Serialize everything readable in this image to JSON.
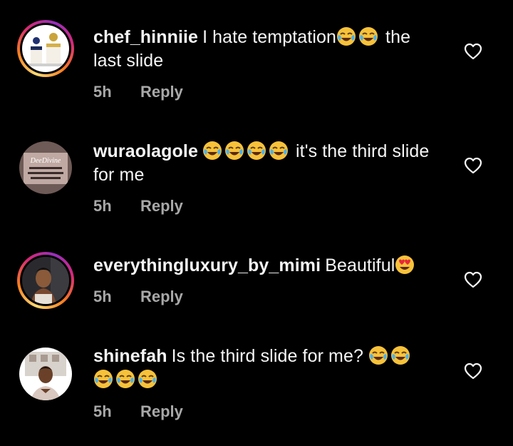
{
  "comments": [
    {
      "username": "chef_hinniie",
      "before": "I hate temptation",
      "emojis_mid": [
        "face-with-tears-of-joy",
        "face-with-tears-of-joy"
      ],
      "after": " the last slide",
      "time": "5h",
      "reply_label": "Reply"
    },
    {
      "username": "wuraolagole",
      "emojis_lead": [
        "face-with-tears-of-joy",
        "face-with-tears-of-joy",
        "face-with-tears-of-joy",
        "face-with-tears-of-joy"
      ],
      "text": " it's the third slide for me",
      "time": "5h",
      "reply_label": "Reply",
      "avatar_text": "DeeDivine"
    },
    {
      "username": "everythingluxury_by_mimi",
      "text": "Beautiful",
      "emojis_trail": [
        "smiling-face-with-heart-eyes"
      ],
      "time": "5h",
      "reply_label": "Reply"
    },
    {
      "username": "shinefah",
      "text": "Is the third slide for me?",
      "emojis_trail": [
        "face-with-tears-of-joy",
        "face-with-tears-of-joy",
        "face-with-tears-of-joy",
        "face-with-tears-of-joy",
        "face-with-tears-of-joy"
      ],
      "time": "5h",
      "reply_label": "Reply"
    }
  ],
  "icons": {
    "like": "heart-outline-icon",
    "emoji_laugh": "face-with-tears-of-joy",
    "emoji_love": "smiling-face-with-heart-eyes"
  },
  "colors": {
    "background": "#000000",
    "text": "#f5f5f5",
    "secondary": "#a8a8a8",
    "story_ring": "#d62976"
  }
}
